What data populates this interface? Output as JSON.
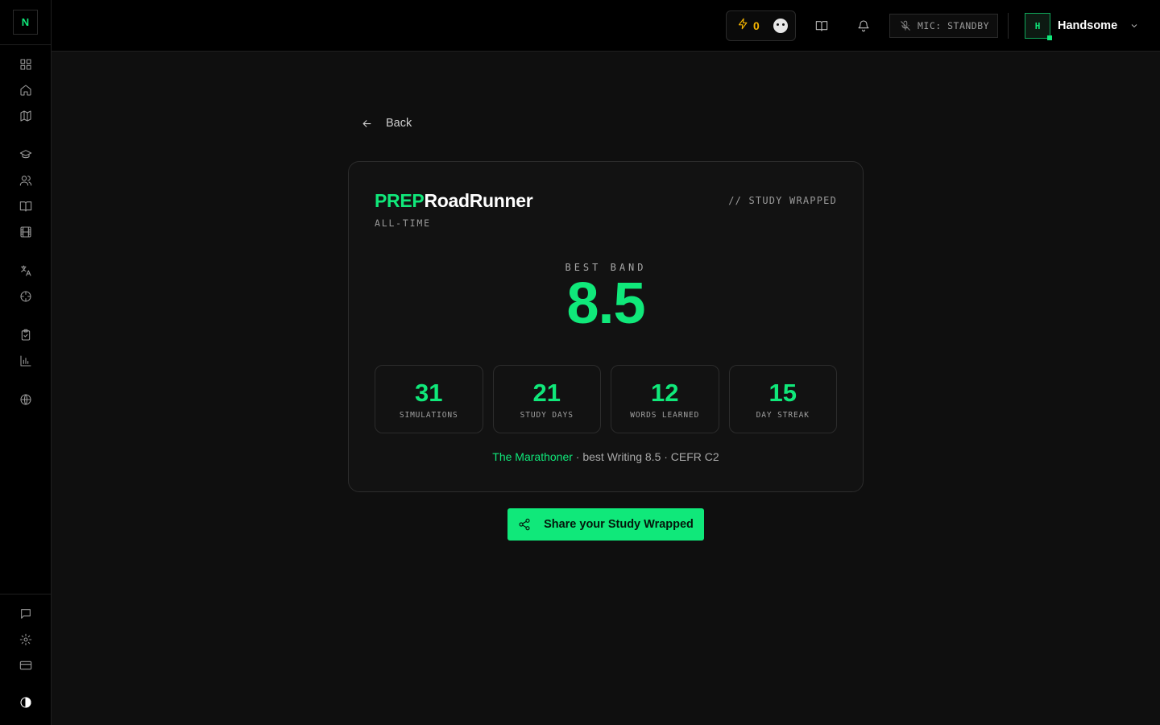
{
  "sidebar": {
    "logo": "N",
    "icons": [
      "dashboard-icon",
      "home-icon",
      "map-icon",
      "graduation-cap-icon",
      "users-icon",
      "book-icon",
      "film-icon",
      "translate-icon",
      "target-icon",
      "clipboard-check-icon",
      "bar-chart-icon",
      "globe-icon",
      "message-icon",
      "gear-icon",
      "credit-card-icon",
      "theme-toggle-icon"
    ]
  },
  "topbar": {
    "energy_count": "0",
    "mic_status": "MIC: STANDBY",
    "avatar_initial": "H",
    "user_name": "Handsome"
  },
  "back": {
    "label": "Back"
  },
  "card": {
    "brand_highlight": "PREP",
    "brand_rest": "RoadRunner",
    "period": "ALL-TIME",
    "tagline": "// STUDY WRAPPED",
    "best_band_label": "BEST BAND",
    "best_band_value": "8.5",
    "stats": [
      {
        "value": "31",
        "label": "SIMULATIONS"
      },
      {
        "value": "21",
        "label": "STUDY DAYS"
      },
      {
        "value": "12",
        "label": "WORDS LEARNED"
      },
      {
        "value": "15",
        "label": "DAY STREAK"
      }
    ],
    "summary_highlight": "The Marathoner",
    "summary_rest": " · best Writing 8.5 · CEFR C2"
  },
  "share": {
    "label": "Share your Study Wrapped"
  },
  "colors": {
    "accent": "#10e87a",
    "energy": "#f5b400",
    "background": "#0f0f0f",
    "chrome": "#000000"
  }
}
